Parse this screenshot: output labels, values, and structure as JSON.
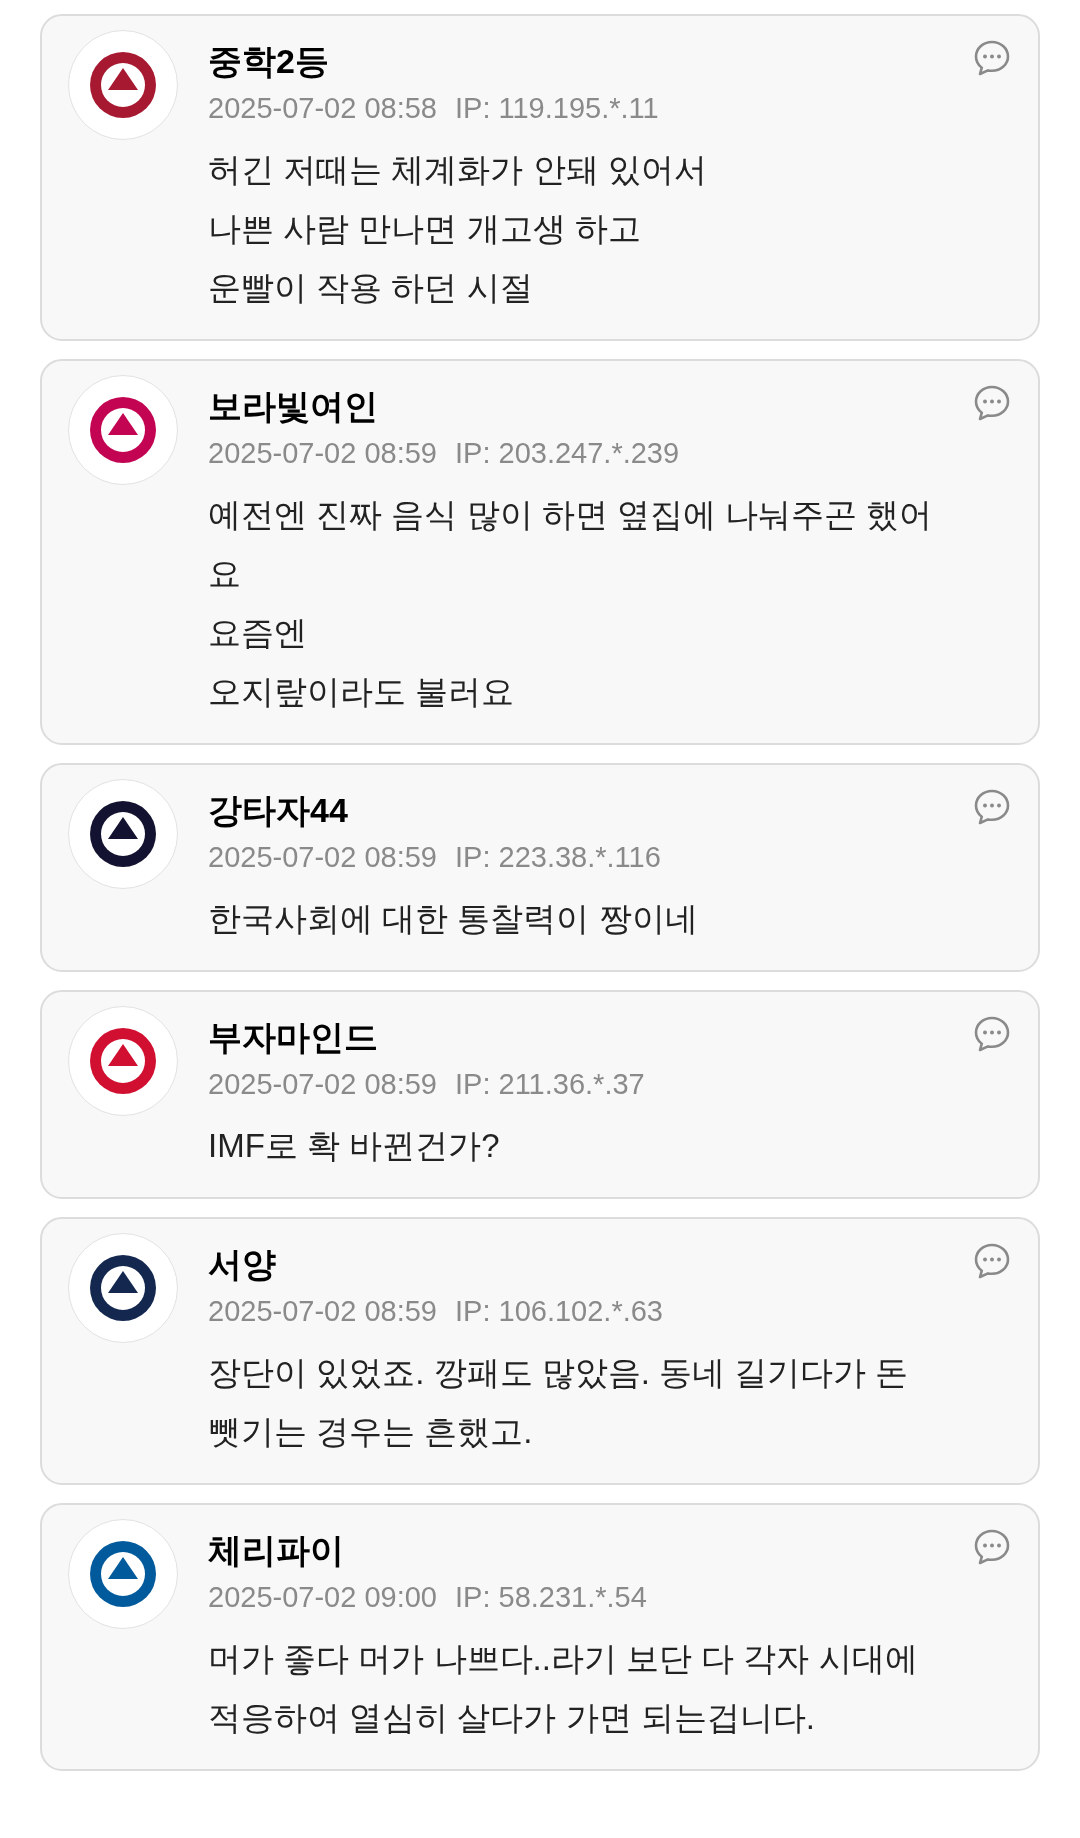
{
  "comments": [
    {
      "author": "중학2등",
      "date": "2025-07-02 08:58",
      "ip": "IP: 119.195.*.11",
      "color": "#a71930",
      "lines": [
        "허긴 저때는 체계화가 안돼 있어서",
        "나쁜 사람 만나면 개고생 하고",
        "운빨이 작용 하던 시절"
      ]
    },
    {
      "author": "보라빛여인",
      "date": "2025-07-02 08:59",
      "ip": "IP: 203.247.*.239",
      "color": "#c30452",
      "lines": [
        "예전엔 진짜 음식 많이 하면 옆집에 나눠주곤 했어",
        "요",
        "요즘엔",
        "오지랖이라도 불러요"
      ]
    },
    {
      "author": "강타자44",
      "date": "2025-07-02 08:59",
      "ip": "IP: 223.38.*.116",
      "color": "#131230",
      "lines": [
        "한국사회에 대한 통찰력이 짱이네"
      ]
    },
    {
      "author": "부자마인드",
      "date": "2025-07-02 08:59",
      "ip": "IP: 211.36.*.37",
      "color": "#d00f31",
      "lines": [
        "IMF로 확 바뀐건가?"
      ]
    },
    {
      "author": "서양",
      "date": "2025-07-02 08:59",
      "ip": "IP: 106.102.*.63",
      "color": "#13274f",
      "lines": [
        "장단이 있었죠. 깡패도 많았음. 동네 길기다가 돈",
        "뺏기는 경우는 흔했고."
      ]
    },
    {
      "author": "체리파이",
      "date": "2025-07-02 09:00",
      "ip": "IP: 58.231.*.54",
      "color": "#005a9c",
      "lines": [
        "머가 좋다 머가 나쁘다..라기 보단 다 각자 시대에",
        "적응하여 열심히 살다가 가면 되는겁니다."
      ]
    }
  ]
}
